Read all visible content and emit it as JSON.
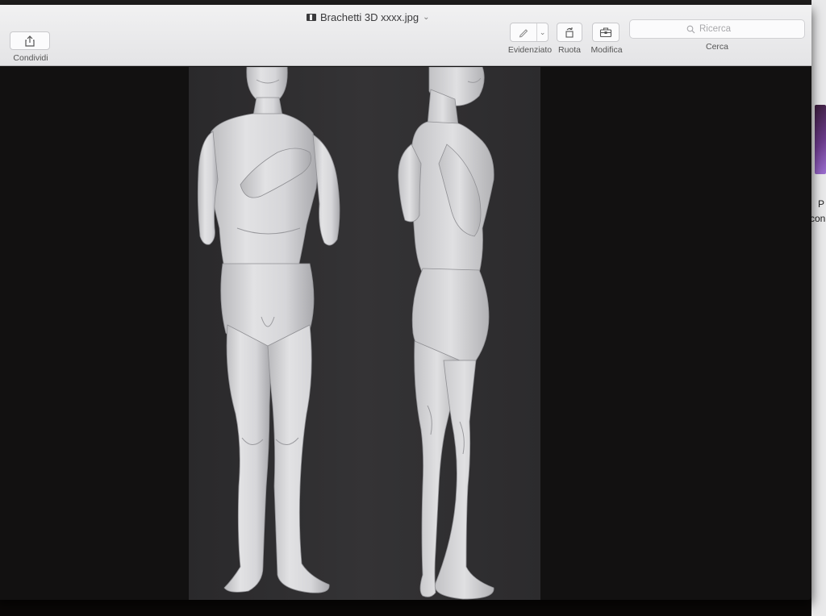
{
  "window": {
    "title": "Brachetti 3D xxxx.jpg"
  },
  "toolbar": {
    "share_label": "Condividi",
    "highlight_label": "Evidenziato",
    "rotate_label": "Ruota",
    "edit_label": "Modifica",
    "search_label": "Cerca"
  },
  "search": {
    "placeholder": "Ricerca"
  },
  "side_window": {
    "text_line1": "P",
    "text_line2": "con"
  },
  "icons": {
    "title": "document-icon",
    "title_menu": "chevron-down-icon",
    "share": "share-icon",
    "highlight": "pen-icon",
    "highlight_menu": "chevron-down-icon",
    "rotate": "rotate-icon",
    "edit": "toolbox-icon",
    "search": "magnifier-icon"
  },
  "colors": {
    "toolbar_bg": "#e8e8ea",
    "canvas_bg": "#121111",
    "image_bg": "#2f2e30",
    "model_fill": "#dcdcde"
  }
}
